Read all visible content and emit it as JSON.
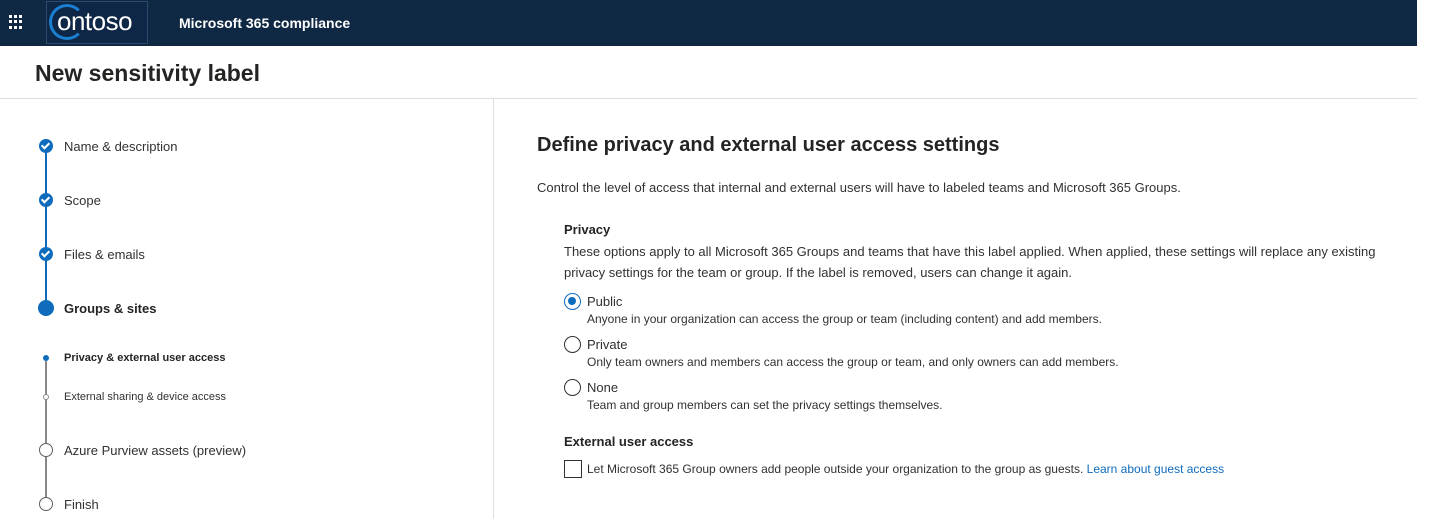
{
  "header": {
    "app_title": "Microsoft 365 compliance",
    "logo_text": "ontoso",
    "brand_color": "#0f2844"
  },
  "page": {
    "title": "New sensitivity label"
  },
  "steps": [
    {
      "label": "Name & description",
      "state": "done"
    },
    {
      "label": "Scope",
      "state": "done"
    },
    {
      "label": "Files & emails",
      "state": "done"
    },
    {
      "label": "Groups & sites",
      "state": "current"
    },
    {
      "label": "Privacy & external user access",
      "state": "sub-current"
    },
    {
      "label": "External sharing & device access",
      "state": "sub-todo"
    },
    {
      "label": "Azure Purview assets (preview)",
      "state": "todo"
    },
    {
      "label": "Finish",
      "state": "todo"
    }
  ],
  "main": {
    "heading": "Define privacy and external user access settings",
    "description": "Control the level of access that internal and external users will have to labeled teams and Microsoft 365 Groups.",
    "privacy": {
      "title": "Privacy",
      "text": "These options apply to all Microsoft 365 Groups and teams that have this label applied. When applied, these settings will replace any existing privacy settings for the team or group. If the label is removed, users can change it again.",
      "options": [
        {
          "label": "Public",
          "description": "Anyone in your organization can access the group or team (including content) and add members.",
          "selected": true
        },
        {
          "label": "Private",
          "description": "Only team owners and members can access the group or team, and only owners can add members.",
          "selected": false
        },
        {
          "label": "None",
          "description": "Team and group members can set the privacy settings themselves.",
          "selected": false
        }
      ]
    },
    "external": {
      "title": "External user access",
      "checkbox_label": "Let Microsoft 365 Group owners add people outside your organization to the group as guests.",
      "link": "Learn about guest access",
      "checked": false
    }
  },
  "accent_color": "#0f6cbd"
}
